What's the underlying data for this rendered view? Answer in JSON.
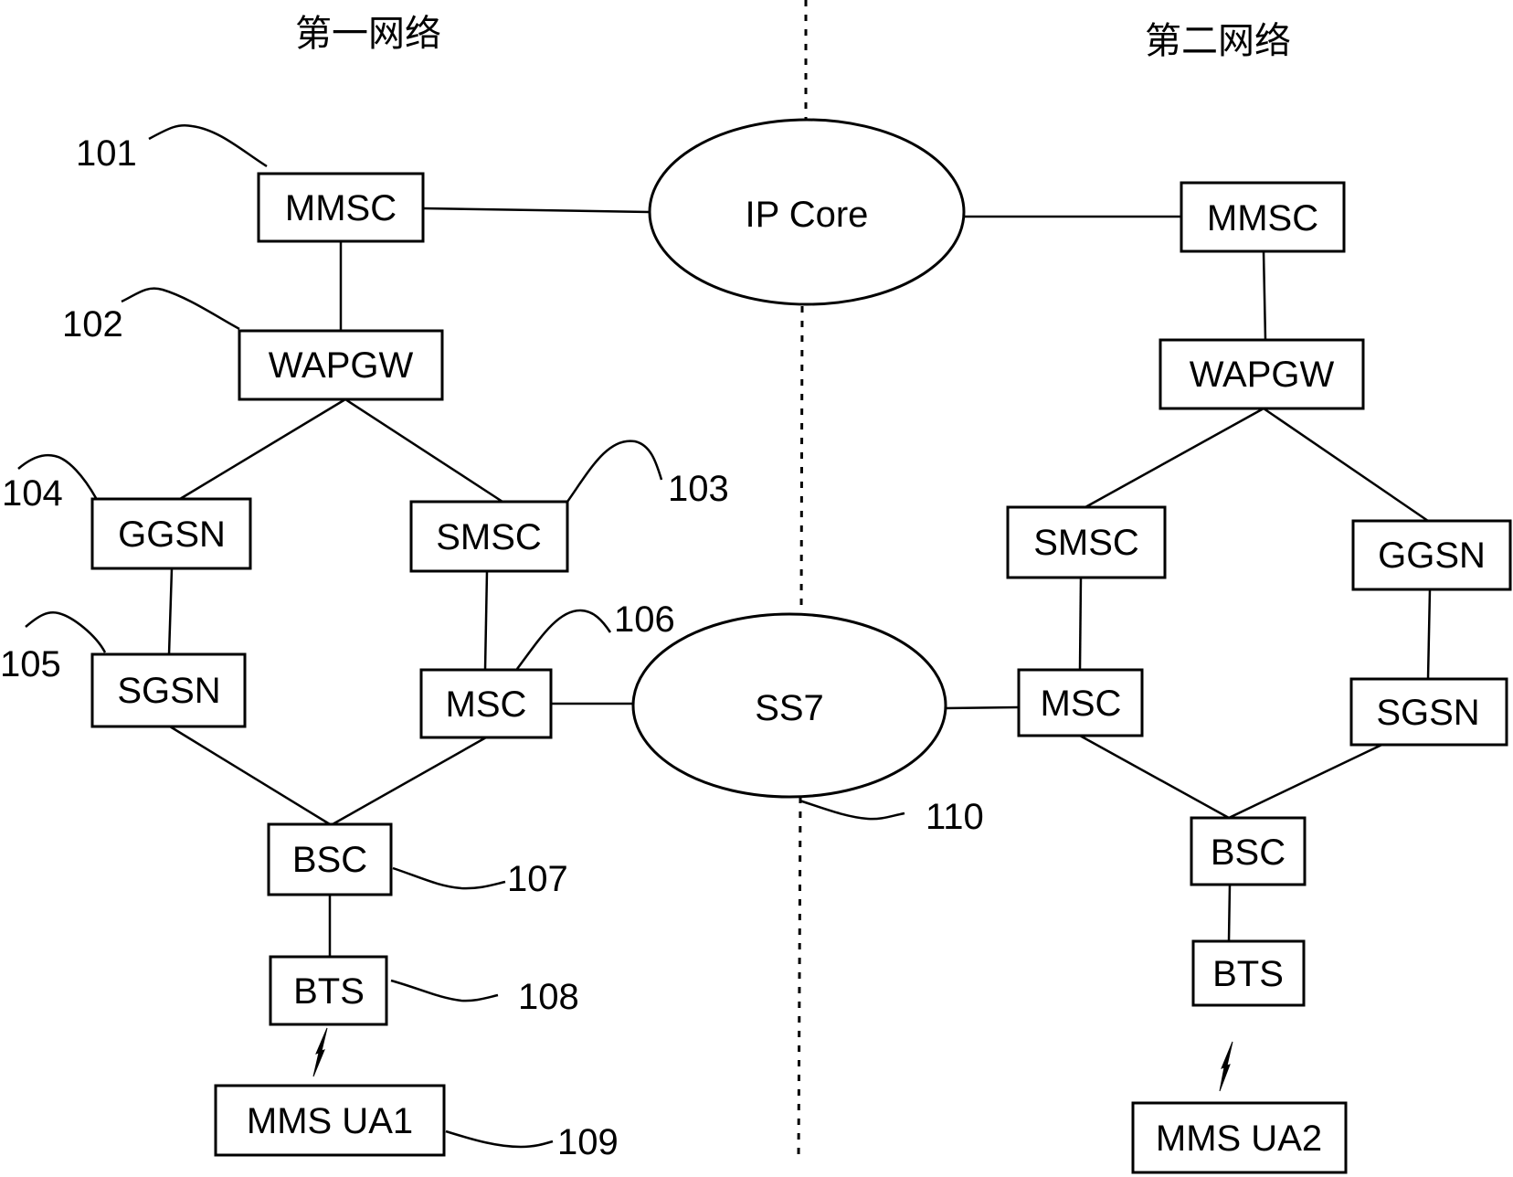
{
  "titles": {
    "first_network": "第一网络",
    "second_network": "第二网络"
  },
  "core": {
    "ip_core": "IP Core",
    "ss7": "SS7"
  },
  "first_network": {
    "mmsc": "MMSC",
    "wapgw": "WAPGW",
    "ggsn": "GGSN",
    "smsc": "SMSC",
    "sgsn": "SGSN",
    "msc": "MSC",
    "bsc": "BSC",
    "bts": "BTS",
    "ua": "MMS UA1"
  },
  "second_network": {
    "mmsc": "MMSC",
    "wapgw": "WAPGW",
    "smsc": "SMSC",
    "ggsn": "GGSN",
    "msc": "MSC",
    "sgsn": "SGSN",
    "bsc": "BSC",
    "bts": "BTS",
    "ua": "MMS UA2"
  },
  "refs": {
    "r101": "101",
    "r102": "102",
    "r103": "103",
    "r104": "104",
    "r105": "105",
    "r106": "106",
    "r107": "107",
    "r108": "108",
    "r109": "109",
    "r110": "110"
  },
  "icons": {
    "wireless_link": "lightning-bolt"
  }
}
